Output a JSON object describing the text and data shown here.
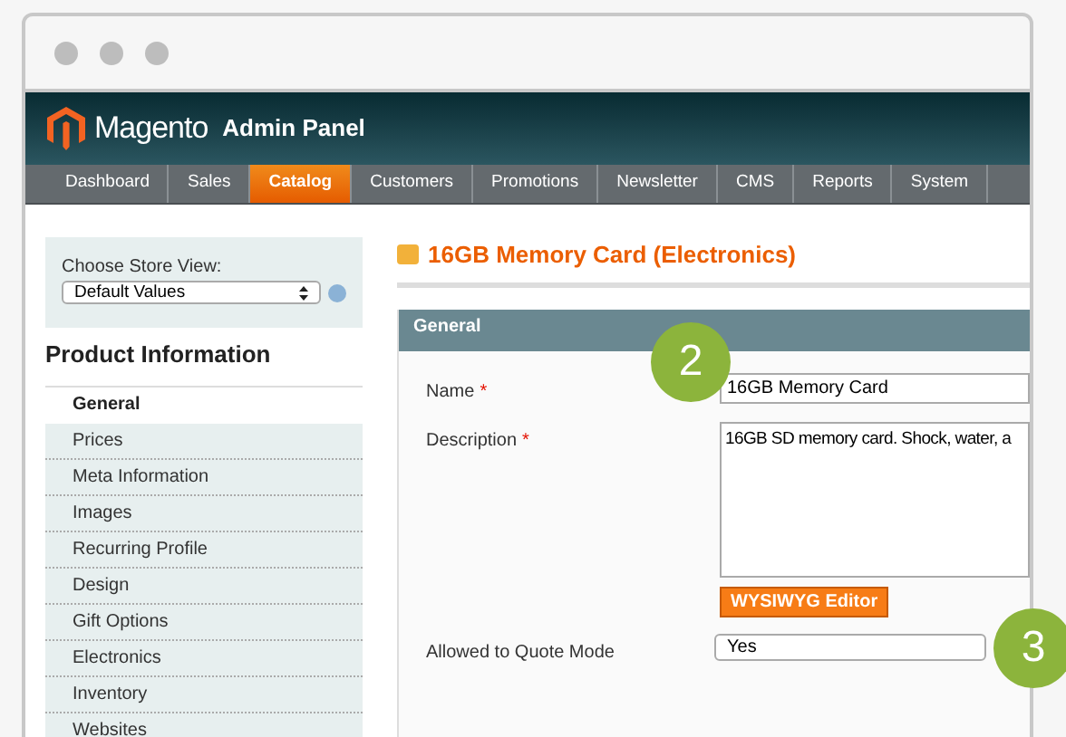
{
  "header": {
    "brand": "Magento",
    "suffix": "Admin Panel"
  },
  "nav": [
    {
      "label": "Dashboard",
      "selected": false
    },
    {
      "label": "Sales",
      "selected": false
    },
    {
      "label": "Catalog",
      "selected": true
    },
    {
      "label": "Customers",
      "selected": false
    },
    {
      "label": "Promotions",
      "selected": false
    },
    {
      "label": "Newsletter",
      "selected": false
    },
    {
      "label": "CMS",
      "selected": false
    },
    {
      "label": "Reports",
      "selected": false
    },
    {
      "label": "System",
      "selected": false
    }
  ],
  "store_view": {
    "label": "Choose Store View:",
    "value": "Default Values"
  },
  "sidebar": {
    "title": "Product Information",
    "items": [
      {
        "label": "General",
        "selected": true
      },
      {
        "label": "Prices",
        "selected": false
      },
      {
        "label": "Meta Information",
        "selected": false
      },
      {
        "label": "Images",
        "selected": false
      },
      {
        "label": "Recurring Profile",
        "selected": false
      },
      {
        "label": "Design",
        "selected": false
      },
      {
        "label": "Gift Options",
        "selected": false
      },
      {
        "label": "Electronics",
        "selected": false
      },
      {
        "label": "Inventory",
        "selected": false
      },
      {
        "label": "Websites",
        "selected": false
      }
    ]
  },
  "page_title": "16GB Memory Card (Electronics)",
  "section": {
    "title": "General",
    "fields": [
      {
        "kind": "text",
        "label": "Name",
        "required": true,
        "value": "16GB Memory Card"
      },
      {
        "kind": "textarea",
        "label": "Description",
        "required": true,
        "value": "16GB SD memory card. Shock, water, a",
        "button": "WYSIWYG Editor"
      },
      {
        "kind": "select",
        "label": "Allowed to Quote Mode",
        "required": false,
        "value": "Yes"
      }
    ]
  },
  "required_mark": "*",
  "callouts": [
    "2",
    "3"
  ]
}
